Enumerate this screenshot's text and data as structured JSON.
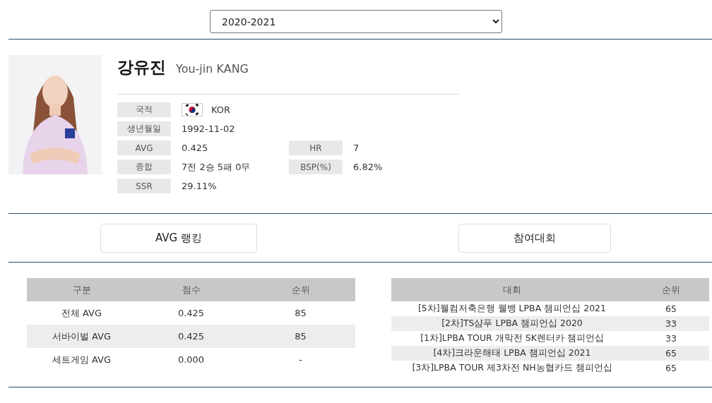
{
  "season_select": {
    "value": "2020-2021"
  },
  "player": {
    "name_ko": "강유진",
    "name_en": "You-jin KANG",
    "info": [
      {
        "label": "국적",
        "value": "KOR",
        "flag": true
      },
      {
        "label": "생년월일",
        "value": "1992-11-02"
      },
      {
        "label": "AVG",
        "value": "0.425",
        "label2": "HR",
        "value2": "7"
      },
      {
        "label": "종합",
        "value": "7전 2승 5패 0무",
        "label2": "BSP(%)",
        "value2": "6.82%"
      },
      {
        "label": "SSR",
        "value": "29.11%"
      }
    ]
  },
  "tab_buttons": [
    "AVG 랭킹",
    "참여대회"
  ],
  "avg_table": {
    "columns": [
      "구분",
      "점수",
      "순위"
    ],
    "rows": [
      [
        "전체 AVG",
        "0.425",
        "85"
      ],
      [
        "서바이벌 AVG",
        "0.425",
        "85"
      ],
      [
        "세트게임 AVG",
        "0.000",
        "-"
      ]
    ]
  },
  "tournament_table": {
    "columns": [
      "대회",
      "순위"
    ],
    "rows": [
      [
        "[5차]웰컴저축은행 웰뱅 LPBA 챔피언십 2021",
        "65"
      ],
      [
        "[2차]TS샴푸 LPBA 챔피언십 2020",
        "33"
      ],
      [
        "[1차]LPBA TOUR 개막전 SK렌터카 챔피언십",
        "33"
      ],
      [
        "[4차]크라운해태 LPBA 챔피언십 2021",
        "65"
      ],
      [
        "[3차]LPBA TOUR 제3차전 NH농협카드 챔피언십",
        "65"
      ]
    ]
  }
}
